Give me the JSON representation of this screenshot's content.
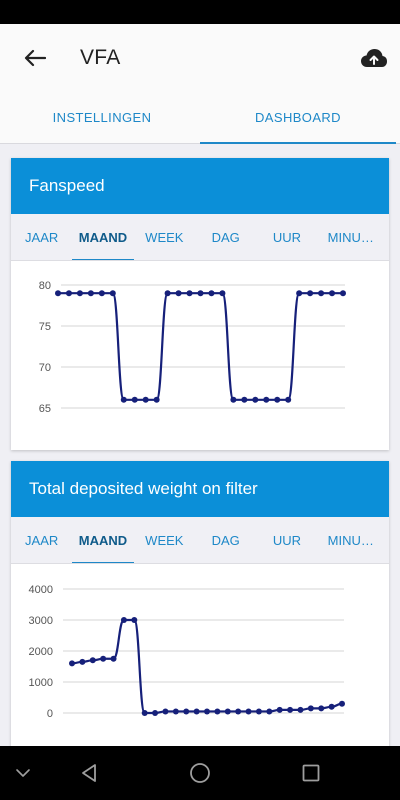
{
  "app": {
    "title": "VFA"
  },
  "top_tabs": [
    {
      "label": "INSTELLINGEN",
      "active": false
    },
    {
      "label": "DASHBOARD",
      "active": true
    }
  ],
  "period_tabs": [
    "JAAR",
    "MAAND",
    "WEEK",
    "DAG",
    "UUR",
    "MINU…"
  ],
  "active_period": "MAAND",
  "colors": {
    "accent": "#0b8fd8",
    "tab_text": "#1e88c8",
    "series": "#16207a"
  },
  "icons": {
    "back": "arrow-left-icon",
    "upload": "cloud-upload-icon"
  },
  "chart_data": [
    {
      "type": "line",
      "title": "Fanspeed",
      "yticks": [
        65,
        70,
        75,
        80
      ],
      "ylim": [
        65,
        80
      ],
      "grid": true,
      "series": [
        {
          "values": [
            79,
            79,
            79,
            79,
            79,
            79,
            66,
            66,
            66,
            66,
            79,
            79,
            79,
            79,
            79,
            79,
            66,
            66,
            66,
            66,
            66,
            66,
            79,
            79,
            79,
            79,
            79
          ]
        }
      ]
    },
    {
      "type": "line",
      "title": "Total deposited weight on filter",
      "yticks": [
        0,
        1000,
        2000,
        3000,
        4000
      ],
      "ylim": [
        0,
        4000
      ],
      "grid": true,
      "series": [
        {
          "values": [
            1600,
            1650,
            1700,
            1750,
            1750,
            3000,
            3000,
            0,
            0,
            50,
            50,
            50,
            50,
            50,
            50,
            50,
            50,
            50,
            50,
            50,
            100,
            100,
            100,
            150,
            150,
            200,
            300
          ]
        }
      ]
    }
  ]
}
